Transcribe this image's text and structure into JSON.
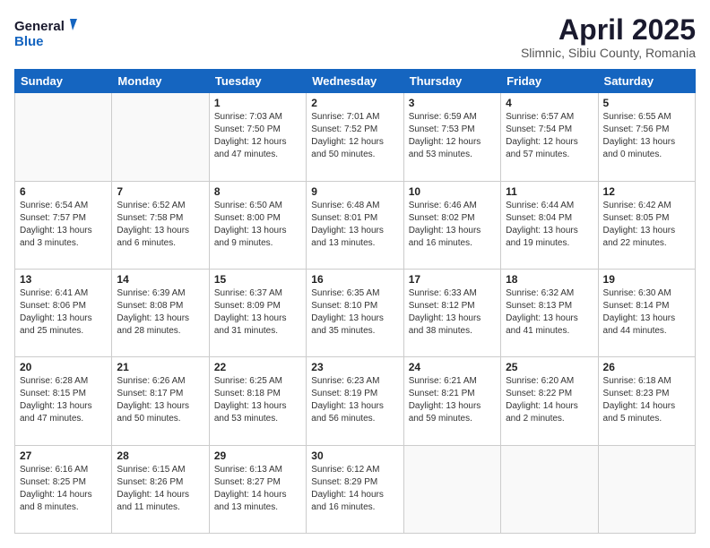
{
  "logo": {
    "general": "General",
    "blue": "Blue"
  },
  "header": {
    "month": "April 2025",
    "location": "Slimnic, Sibiu County, Romania"
  },
  "days_of_week": [
    "Sunday",
    "Monday",
    "Tuesday",
    "Wednesday",
    "Thursday",
    "Friday",
    "Saturday"
  ],
  "weeks": [
    [
      {
        "day": "",
        "info": ""
      },
      {
        "day": "",
        "info": ""
      },
      {
        "day": "1",
        "info": "Sunrise: 7:03 AM\nSunset: 7:50 PM\nDaylight: 12 hours and 47 minutes."
      },
      {
        "day": "2",
        "info": "Sunrise: 7:01 AM\nSunset: 7:52 PM\nDaylight: 12 hours and 50 minutes."
      },
      {
        "day": "3",
        "info": "Sunrise: 6:59 AM\nSunset: 7:53 PM\nDaylight: 12 hours and 53 minutes."
      },
      {
        "day": "4",
        "info": "Sunrise: 6:57 AM\nSunset: 7:54 PM\nDaylight: 12 hours and 57 minutes."
      },
      {
        "day": "5",
        "info": "Sunrise: 6:55 AM\nSunset: 7:56 PM\nDaylight: 13 hours and 0 minutes."
      }
    ],
    [
      {
        "day": "6",
        "info": "Sunrise: 6:54 AM\nSunset: 7:57 PM\nDaylight: 13 hours and 3 minutes."
      },
      {
        "day": "7",
        "info": "Sunrise: 6:52 AM\nSunset: 7:58 PM\nDaylight: 13 hours and 6 minutes."
      },
      {
        "day": "8",
        "info": "Sunrise: 6:50 AM\nSunset: 8:00 PM\nDaylight: 13 hours and 9 minutes."
      },
      {
        "day": "9",
        "info": "Sunrise: 6:48 AM\nSunset: 8:01 PM\nDaylight: 13 hours and 13 minutes."
      },
      {
        "day": "10",
        "info": "Sunrise: 6:46 AM\nSunset: 8:02 PM\nDaylight: 13 hours and 16 minutes."
      },
      {
        "day": "11",
        "info": "Sunrise: 6:44 AM\nSunset: 8:04 PM\nDaylight: 13 hours and 19 minutes."
      },
      {
        "day": "12",
        "info": "Sunrise: 6:42 AM\nSunset: 8:05 PM\nDaylight: 13 hours and 22 minutes."
      }
    ],
    [
      {
        "day": "13",
        "info": "Sunrise: 6:41 AM\nSunset: 8:06 PM\nDaylight: 13 hours and 25 minutes."
      },
      {
        "day": "14",
        "info": "Sunrise: 6:39 AM\nSunset: 8:08 PM\nDaylight: 13 hours and 28 minutes."
      },
      {
        "day": "15",
        "info": "Sunrise: 6:37 AM\nSunset: 8:09 PM\nDaylight: 13 hours and 31 minutes."
      },
      {
        "day": "16",
        "info": "Sunrise: 6:35 AM\nSunset: 8:10 PM\nDaylight: 13 hours and 35 minutes."
      },
      {
        "day": "17",
        "info": "Sunrise: 6:33 AM\nSunset: 8:12 PM\nDaylight: 13 hours and 38 minutes."
      },
      {
        "day": "18",
        "info": "Sunrise: 6:32 AM\nSunset: 8:13 PM\nDaylight: 13 hours and 41 minutes."
      },
      {
        "day": "19",
        "info": "Sunrise: 6:30 AM\nSunset: 8:14 PM\nDaylight: 13 hours and 44 minutes."
      }
    ],
    [
      {
        "day": "20",
        "info": "Sunrise: 6:28 AM\nSunset: 8:15 PM\nDaylight: 13 hours and 47 minutes."
      },
      {
        "day": "21",
        "info": "Sunrise: 6:26 AM\nSunset: 8:17 PM\nDaylight: 13 hours and 50 minutes."
      },
      {
        "day": "22",
        "info": "Sunrise: 6:25 AM\nSunset: 8:18 PM\nDaylight: 13 hours and 53 minutes."
      },
      {
        "day": "23",
        "info": "Sunrise: 6:23 AM\nSunset: 8:19 PM\nDaylight: 13 hours and 56 minutes."
      },
      {
        "day": "24",
        "info": "Sunrise: 6:21 AM\nSunset: 8:21 PM\nDaylight: 13 hours and 59 minutes."
      },
      {
        "day": "25",
        "info": "Sunrise: 6:20 AM\nSunset: 8:22 PM\nDaylight: 14 hours and 2 minutes."
      },
      {
        "day": "26",
        "info": "Sunrise: 6:18 AM\nSunset: 8:23 PM\nDaylight: 14 hours and 5 minutes."
      }
    ],
    [
      {
        "day": "27",
        "info": "Sunrise: 6:16 AM\nSunset: 8:25 PM\nDaylight: 14 hours and 8 minutes."
      },
      {
        "day": "28",
        "info": "Sunrise: 6:15 AM\nSunset: 8:26 PM\nDaylight: 14 hours and 11 minutes."
      },
      {
        "day": "29",
        "info": "Sunrise: 6:13 AM\nSunset: 8:27 PM\nDaylight: 14 hours and 13 minutes."
      },
      {
        "day": "30",
        "info": "Sunrise: 6:12 AM\nSunset: 8:29 PM\nDaylight: 14 hours and 16 minutes."
      },
      {
        "day": "",
        "info": ""
      },
      {
        "day": "",
        "info": ""
      },
      {
        "day": "",
        "info": ""
      }
    ]
  ]
}
